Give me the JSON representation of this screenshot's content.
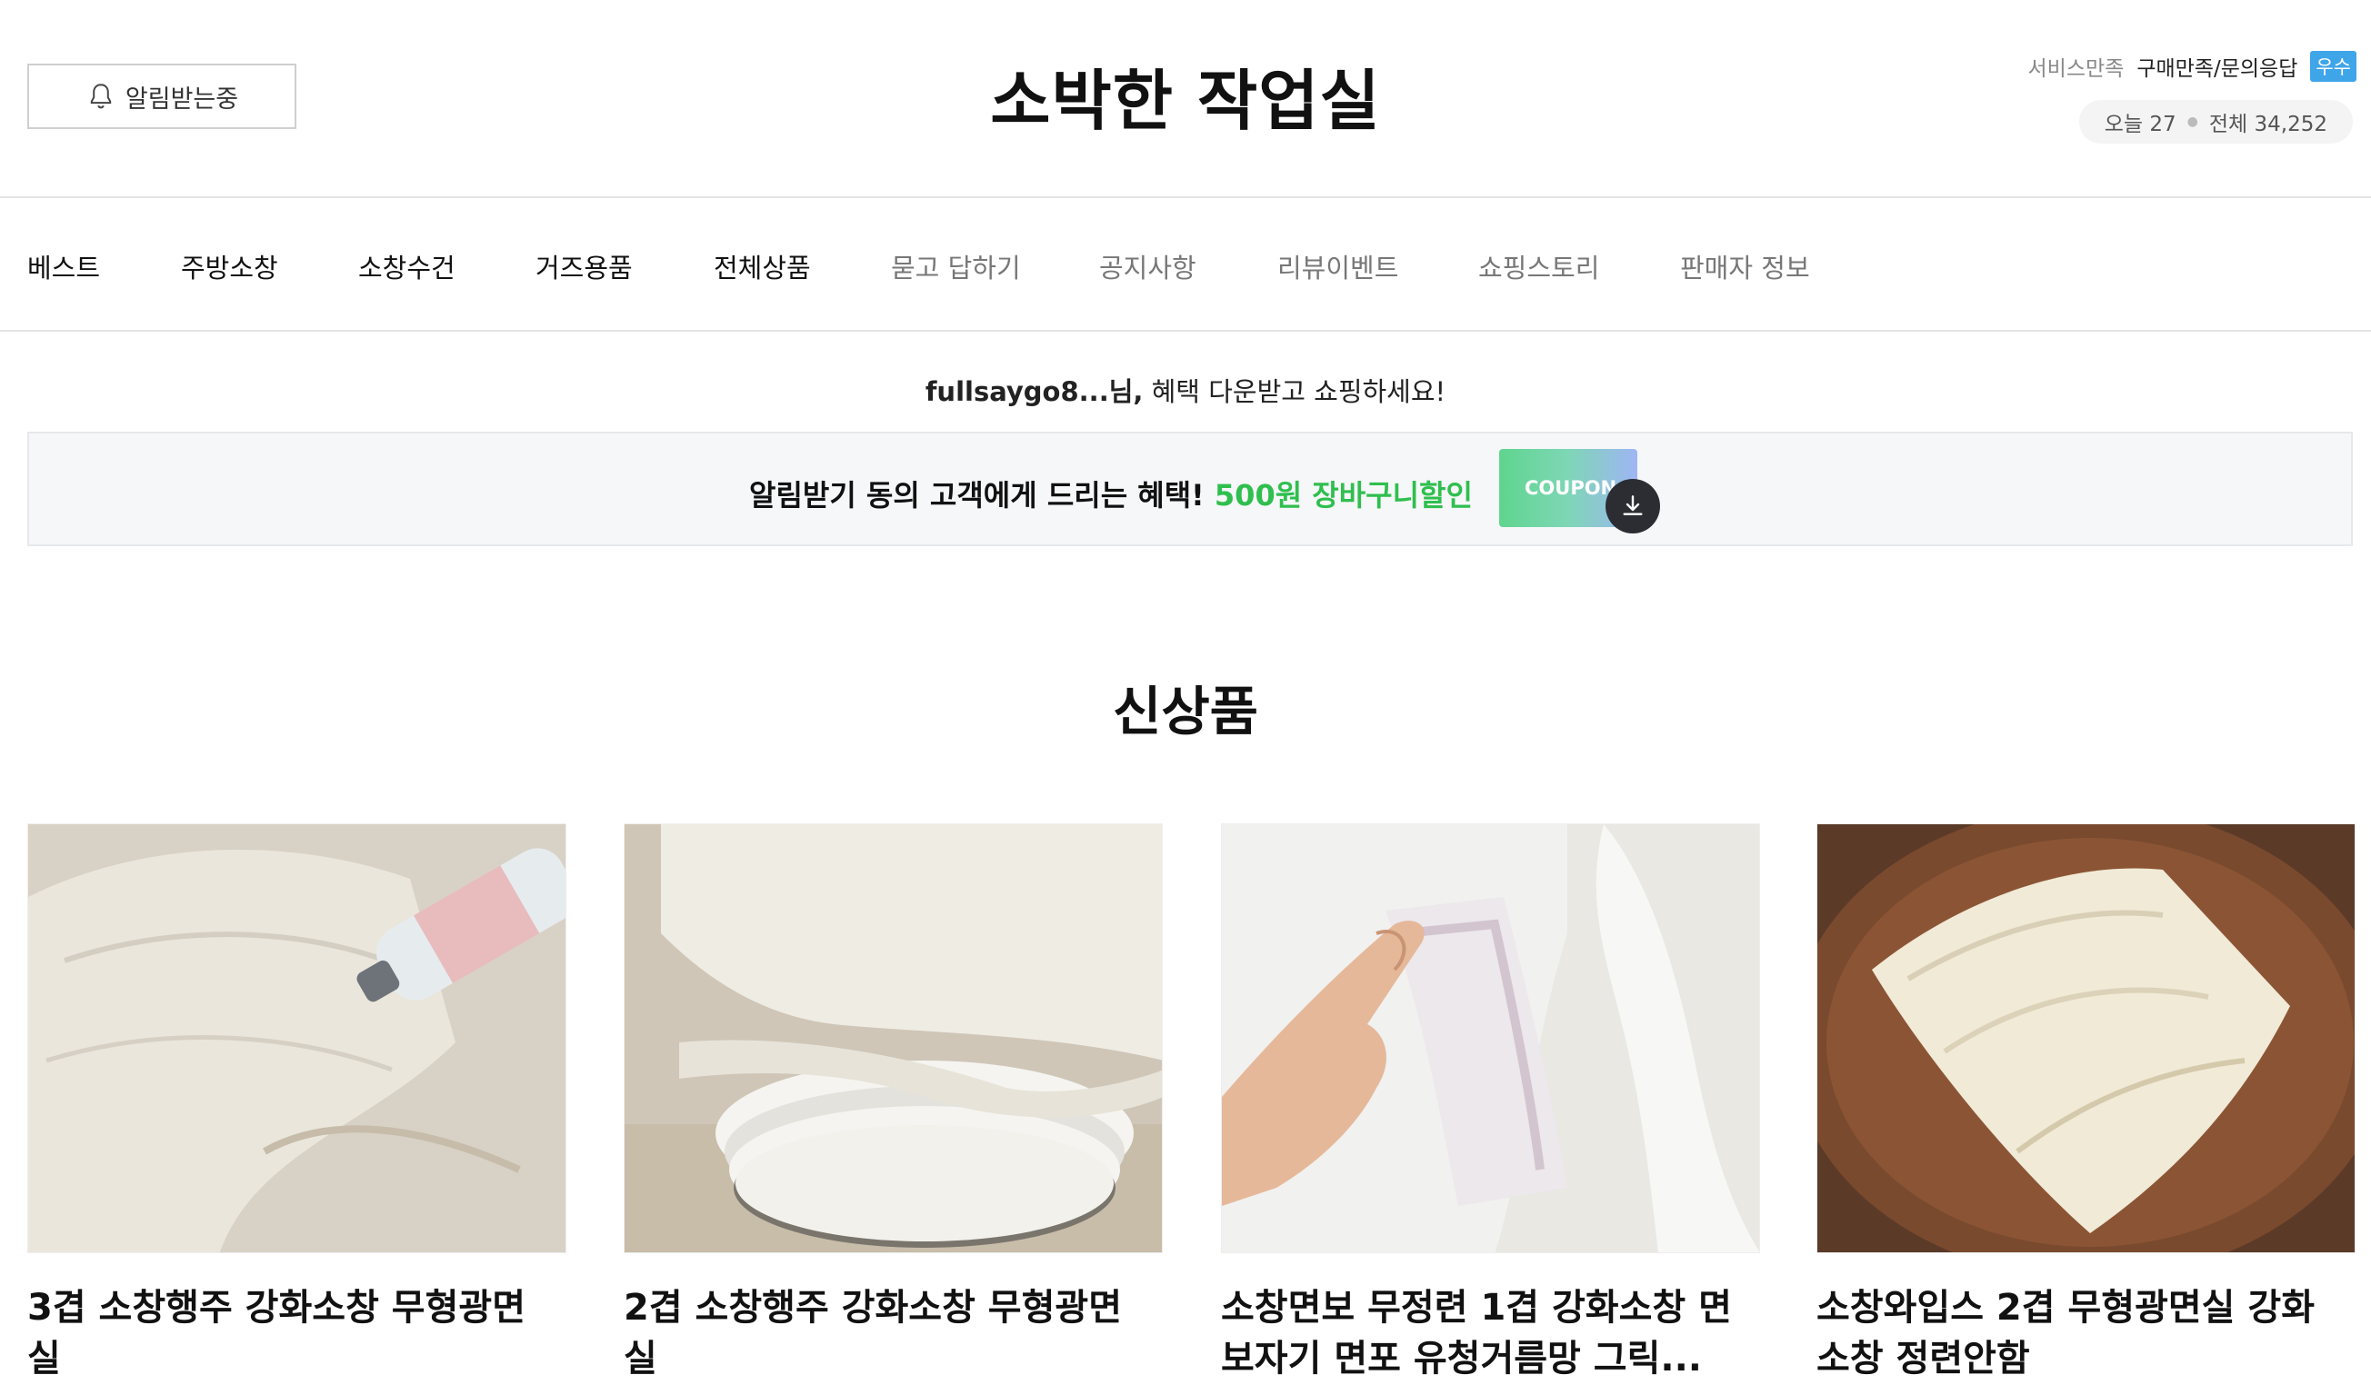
{
  "header": {
    "notify_label": "알림받는중",
    "store_title": "소박한 작업실",
    "service_label": "서비스만족",
    "rating_label": "구매만족/문의응답",
    "rating_badge": "우수",
    "today_label": "오늘 27",
    "total_label": "전체 34,252"
  },
  "nav": {
    "items": [
      "베스트",
      "주방소창",
      "소창수건",
      "거즈용품",
      "전체상품",
      "묻고 답하기",
      "공지사항",
      "리뷰이벤트",
      "쇼핑스토리",
      "판매자 정보"
    ]
  },
  "benefit": {
    "user": "fullsaygo8...님,",
    "message": " 혜택 다운받고 쇼핑하세요!",
    "coupon_prefix": "알림받기 동의 고객에게 드리는 혜택!",
    "coupon_highlight": "500원 장바구니할인",
    "coupon_button": "COUPON"
  },
  "section": {
    "title": "신상품"
  },
  "products": [
    {
      "line1": "3겹 소창행주 강화소창 무형광면",
      "line2": "실"
    },
    {
      "line1": "2겹 소창행주 강화소창 무형광면",
      "line2": "실"
    },
    {
      "line1": "소창면보 무정련 1겹 강화소창 면",
      "line2": "보자기 면포 유청거름망 그릭..."
    },
    {
      "line1": "소창와입스 2겹 무형광면실 강화",
      "line2": "소창 정련안함"
    }
  ],
  "colors": {
    "accent_green": "#2fbf4e",
    "badge_blue": "#3fa5e9"
  }
}
